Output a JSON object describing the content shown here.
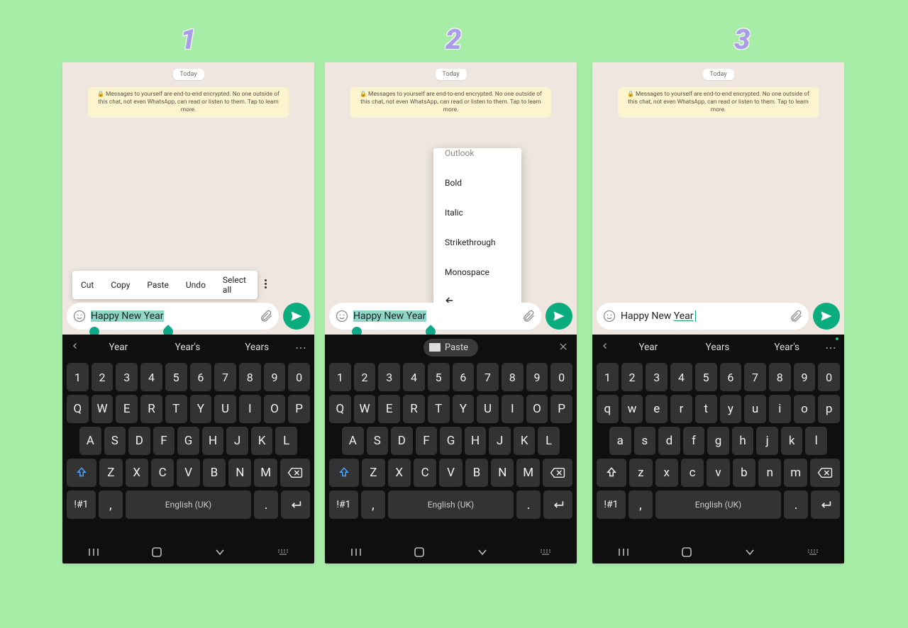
{
  "step_labels": {
    "one": "1",
    "two": "2",
    "three": "3"
  },
  "common": {
    "date_label": "Today",
    "encryption_notice": "Messages to yourself are end-to-end encrypted. No one outside of this chat, not even WhatsApp, can read or listen to them. Tap to learn more."
  },
  "phone1": {
    "message_text": "Happy New Year",
    "context_menu": {
      "cut": "Cut",
      "copy": "Copy",
      "paste": "Paste",
      "undo": "Undo",
      "select_all": "Select all"
    },
    "suggestions": {
      "s1": "Year",
      "s2": "Year's",
      "s3": "Years"
    }
  },
  "phone2": {
    "message_text": "Happy New Year",
    "format_menu": {
      "outlook": "Outlook",
      "bold": "Bold",
      "italic": "Italic",
      "strike": "Strikethrough",
      "mono": "Monospace"
    },
    "paste_label": "Paste"
  },
  "phone3": {
    "message_prefix": "Happy New ",
    "message_underlined": "Year",
    "suggestions": {
      "s1": "Year",
      "s2": "Years",
      "s3": "Year's"
    }
  },
  "keyboard": {
    "numbers": [
      "1",
      "2",
      "3",
      "4",
      "5",
      "6",
      "7",
      "8",
      "9",
      "0"
    ],
    "row1_upper": [
      "Q",
      "W",
      "E",
      "R",
      "T",
      "Y",
      "U",
      "I",
      "O",
      "P"
    ],
    "row2_upper": [
      "A",
      "S",
      "D",
      "F",
      "G",
      "H",
      "J",
      "K",
      "L"
    ],
    "row3_upper": [
      "Z",
      "X",
      "C",
      "V",
      "B",
      "N",
      "M"
    ],
    "row1_lower": [
      "q",
      "w",
      "e",
      "r",
      "t",
      "y",
      "u",
      "i",
      "o",
      "p"
    ],
    "row2_lower": [
      "a",
      "s",
      "d",
      "f",
      "g",
      "h",
      "j",
      "k",
      "l"
    ],
    "row3_lower": [
      "z",
      "x",
      "c",
      "v",
      "b",
      "n",
      "m"
    ],
    "sym": "!#1",
    "comma": ",",
    "space": "English (UK)",
    "period": "."
  }
}
